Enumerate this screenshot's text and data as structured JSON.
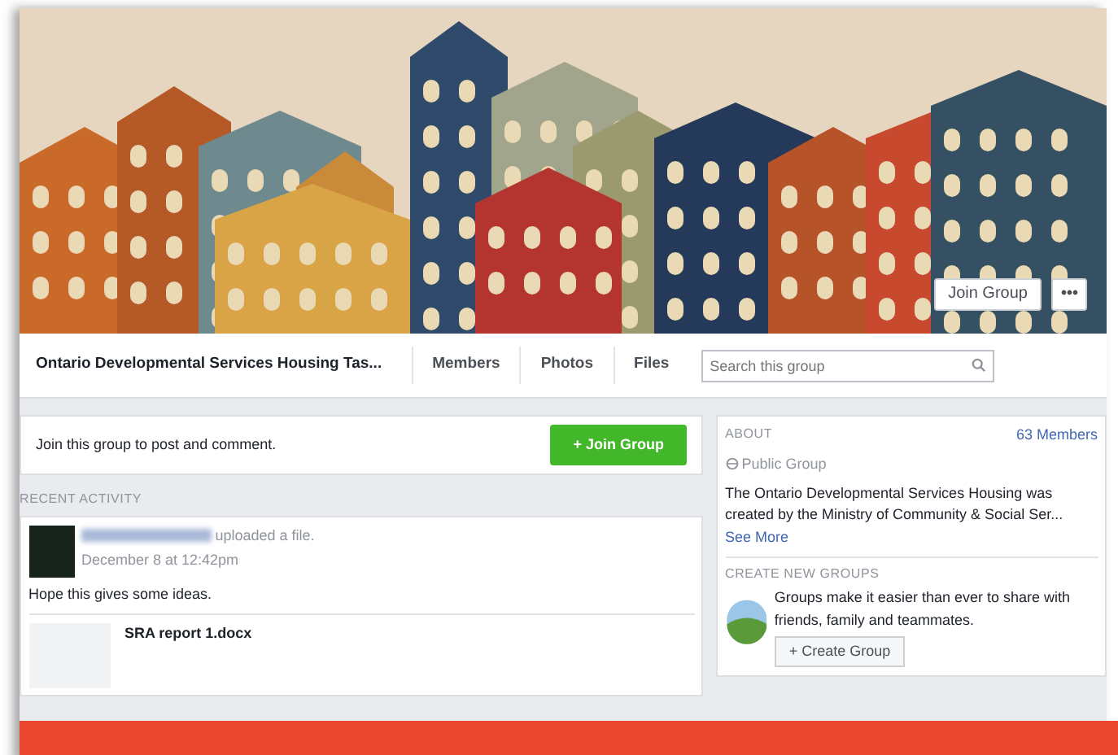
{
  "cover": {
    "buttons": [
      {
        "kind": "text",
        "label": "Join Group"
      },
      {
        "kind": "more",
        "label": "•••"
      }
    ]
  },
  "group_nav": {
    "title": "Ontario Developmental Services Housing Tas...",
    "tabs": [
      {
        "label": "Members",
        "selected": false
      },
      {
        "label": "Photos",
        "selected": false
      },
      {
        "label": "Files",
        "selected": false
      }
    ],
    "search": {
      "placeholder": "Search this group"
    }
  },
  "join_prompt": {
    "text": "Join this group to post and comment.",
    "button": "+ Join Group"
  },
  "recent_activity": {
    "heading": "RECENT ACTIVITY",
    "post": {
      "action": "uploaded a file.",
      "time": "December 8 at 12:42pm",
      "text": "Hope this gives some ideas.",
      "attachment": "SRA report 1.docx"
    }
  },
  "about": {
    "heading": "ABOUT",
    "members": "63 Members",
    "privacy": "Public Group",
    "description": "The Ontario Developmental Services Housing was created by the Ministry of Community & Social Ser...",
    "see_more": "See More"
  },
  "create_groups": {
    "heading": "CREATE NEW GROUPS",
    "text": "Groups make it easier than ever to share with friends, family and teammates.",
    "button": "+ Create Group"
  }
}
